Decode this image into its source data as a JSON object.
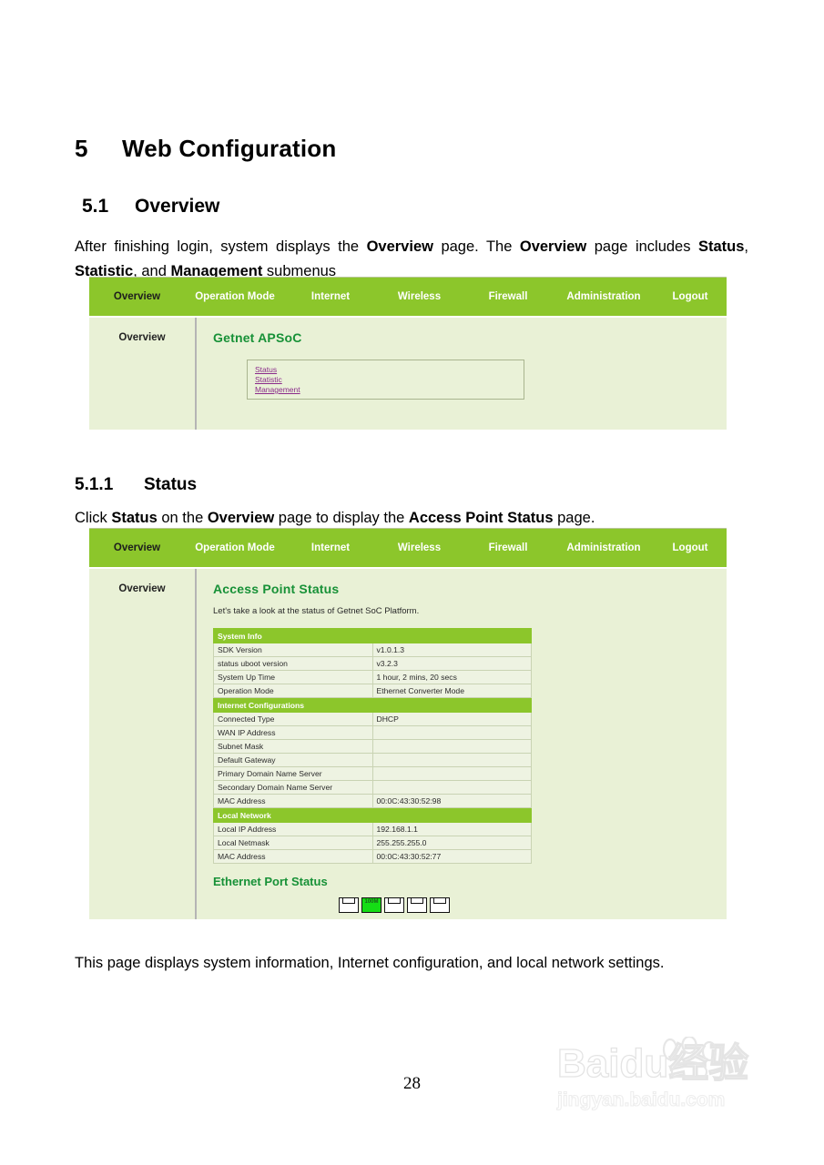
{
  "document": {
    "chapter_number": "5",
    "chapter_title": "Web Configuration",
    "section_number": "5.1",
    "section_title": "Overview",
    "subsection_number": "5.1.1",
    "subsection_title": "Status",
    "page_number": "28",
    "paragraphs": {
      "intro_1": "After finishing login, system displays the ",
      "intro_b1": "Overview",
      "intro_2": " page. The ",
      "intro_b2": "Overview",
      "intro_3": " page includes ",
      "intro_b3": "Status",
      "intro_4": ", ",
      "intro_b4": "Statistic",
      "intro_5": ", and ",
      "intro_b5": "Management",
      "intro_6": " submenus",
      "status_1": "Click ",
      "status_b1": "Status",
      "status_2": " on the ",
      "status_b2": "Overview",
      "status_3": " page to display the ",
      "status_b3": "Access Point Status",
      "status_4": " page.",
      "footer": "This page displays system information, Internet configuration, and local network settings."
    }
  },
  "watermark": {
    "brand": "Baidu",
    "brand_cn": "经验",
    "url": "jingyan.baidu.com"
  },
  "screenshot_overview": {
    "nav": [
      {
        "label": "Overview"
      },
      {
        "label": "Operation Mode"
      },
      {
        "label": "Internet"
      },
      {
        "label": "Wireless"
      },
      {
        "label": "Firewall"
      },
      {
        "label": "Administration"
      },
      {
        "label": "Logout"
      }
    ],
    "sidebar": {
      "item": "Overview"
    },
    "content": {
      "title": "Getnet APSoC",
      "links": [
        {
          "label": "Status"
        },
        {
          "label": "Statistic"
        },
        {
          "label": "Management"
        }
      ]
    }
  },
  "screenshot_status": {
    "nav": [
      {
        "label": "Overview"
      },
      {
        "label": "Operation Mode"
      },
      {
        "label": "Internet"
      },
      {
        "label": "Wireless"
      },
      {
        "label": "Firewall"
      },
      {
        "label": "Administration"
      },
      {
        "label": "Logout"
      }
    ],
    "sidebar": {
      "item": "Overview"
    },
    "content": {
      "title": "Access Point Status",
      "subtitle": "Let's take a look at the status of Getnet SoC Platform.",
      "groups": [
        {
          "header": "System Info",
          "rows": [
            {
              "label": "SDK Version",
              "value": "v1.0.1.3"
            },
            {
              "label": "status uboot version",
              "value": "v3.2.3"
            },
            {
              "label": "System Up Time",
              "value": "1 hour, 2 mins, 20 secs"
            },
            {
              "label": "Operation Mode",
              "value": "Ethernet Converter Mode"
            }
          ]
        },
        {
          "header": "Internet Configurations",
          "rows": [
            {
              "label": "Connected Type",
              "value": "DHCP"
            },
            {
              "label": "WAN IP Address",
              "value": ""
            },
            {
              "label": "Subnet Mask",
              "value": ""
            },
            {
              "label": "Default Gateway",
              "value": ""
            },
            {
              "label": "Primary Domain Name Server",
              "value": ""
            },
            {
              "label": "Secondary Domain Name Server",
              "value": ""
            },
            {
              "label": "MAC Address",
              "value": "00:0C:43:30:52:98"
            }
          ]
        },
        {
          "header": "Local Network",
          "rows": [
            {
              "label": "Local IP Address",
              "value": "192.168.1.1"
            },
            {
              "label": "Local Netmask",
              "value": "255.255.255.0"
            },
            {
              "label": "MAC Address",
              "value": "00:0C:43:30:52:77"
            }
          ]
        }
      ],
      "ethernet_port_status": {
        "title": "Ethernet Port Status",
        "ports": [
          {
            "state": "down",
            "speed": ""
          },
          {
            "state": "up",
            "speed": "100M"
          },
          {
            "state": "down",
            "speed": ""
          },
          {
            "state": "down",
            "speed": ""
          },
          {
            "state": "down",
            "speed": ""
          }
        ]
      }
    }
  },
  "colors": {
    "nav_green": "#8CC62B",
    "panel_bg": "#E9F1D6",
    "heading_green": "#179137",
    "link_purple": "#8A2B8A",
    "port_active": "#15DD15"
  }
}
